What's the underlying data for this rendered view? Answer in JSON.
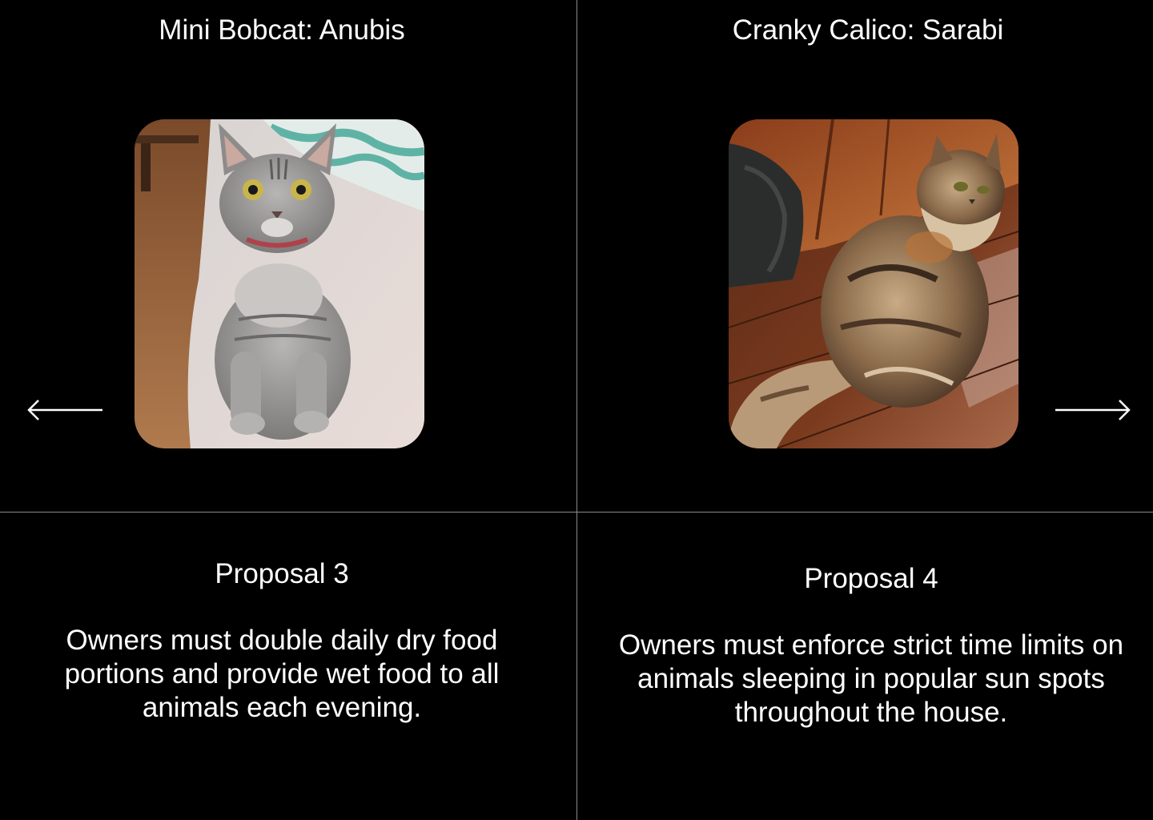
{
  "colors": {
    "background": "#000000",
    "text": "#ffffff",
    "divider": "#8a8a8a"
  },
  "left_panel": {
    "cat_title": "Mini Bobcat: Anubis",
    "photo_subject": "gray tabby cat sitting on a bed",
    "nav_icon": "arrow-left-icon"
  },
  "right_panel": {
    "cat_title": "Cranky Calico: Sarabi",
    "photo_subject": "long-haired calico cat sitting on a wooden floor",
    "nav_icon": "arrow-right-icon"
  },
  "proposals": [
    {
      "title": "Proposal 3",
      "text": "Owners must double daily dry food portions and provide wet food to all animals each evening."
    },
    {
      "title": "Proposal 4",
      "text": "Owners must enforce strict time limits on animals sleeping in popular sun spots throughout the house."
    }
  ]
}
